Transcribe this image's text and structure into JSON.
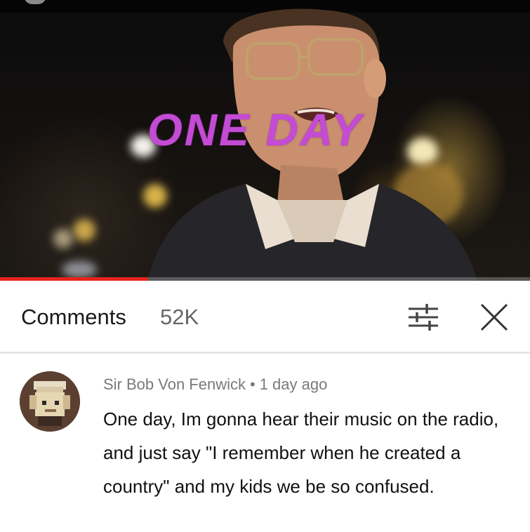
{
  "video": {
    "overlay_title": "ONE DAY",
    "progress": 0.28,
    "accent_color": "#e8231c",
    "overlay_color": "#c44bd4"
  },
  "comments_panel": {
    "title": "Comments",
    "count": "52K",
    "filter_icon": "sliders-icon",
    "close_icon": "close-icon"
  },
  "comment": {
    "author": "Sir Bob Von Fenwick",
    "separator": "•",
    "time": "1 day ago",
    "text": "One day, Im gonna hear their music on the radio, and just say \"I remember when he created a country\" and my kids we be so confused.",
    "avatar_icon": "blocky-character-avatar"
  }
}
